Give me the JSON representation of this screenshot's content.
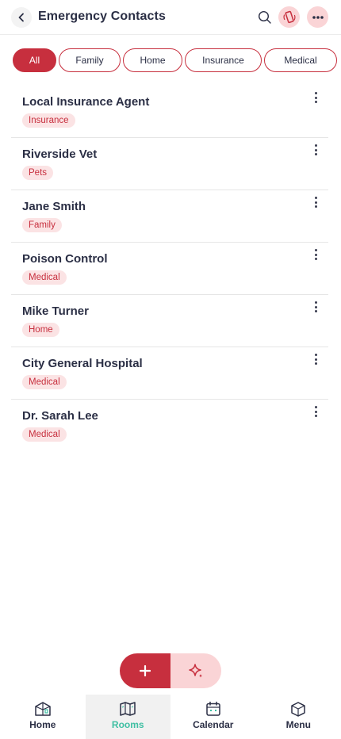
{
  "header": {
    "title": "Emergency Contacts",
    "back_icon": "chevron-left-icon",
    "search_icon": "search-icon",
    "phone_icon": "phone-ringing-icon",
    "more_icon": "more-horizontal-icon"
  },
  "filters": [
    {
      "label": "All",
      "active": true
    },
    {
      "label": "Family",
      "active": false
    },
    {
      "label": "Home",
      "active": false
    },
    {
      "label": "Insurance",
      "active": false
    },
    {
      "label": "Medical",
      "active": false
    }
  ],
  "contacts": [
    {
      "name": "Local Insurance Agent",
      "tag": "Insurance"
    },
    {
      "name": "Riverside Vet",
      "tag": "Pets"
    },
    {
      "name": "Jane Smith",
      "tag": "Family"
    },
    {
      "name": "Poison Control",
      "tag": "Medical"
    },
    {
      "name": "Mike Turner",
      "tag": "Home"
    },
    {
      "name": "City General Hospital",
      "tag": "Medical"
    },
    {
      "name": "Dr. Sarah Lee",
      "tag": "Medical"
    }
  ],
  "fab": {
    "add_icon": "plus-icon",
    "ai_icon": "sparkle-icon"
  },
  "bottom_nav": [
    {
      "label": "Home",
      "icon": "house-icon",
      "active": false
    },
    {
      "label": "Rooms",
      "icon": "map-icon",
      "active": true
    },
    {
      "label": "Calendar",
      "icon": "calendar-icon",
      "active": false
    },
    {
      "label": "Menu",
      "icon": "cube-icon",
      "active": false
    }
  ],
  "colors": {
    "accent": "#c72f3e",
    "accent_light": "#fad4d6",
    "tag_bg": "#fbe3e4",
    "active_nav": "#3fbfa3",
    "text": "#2b2f45"
  }
}
